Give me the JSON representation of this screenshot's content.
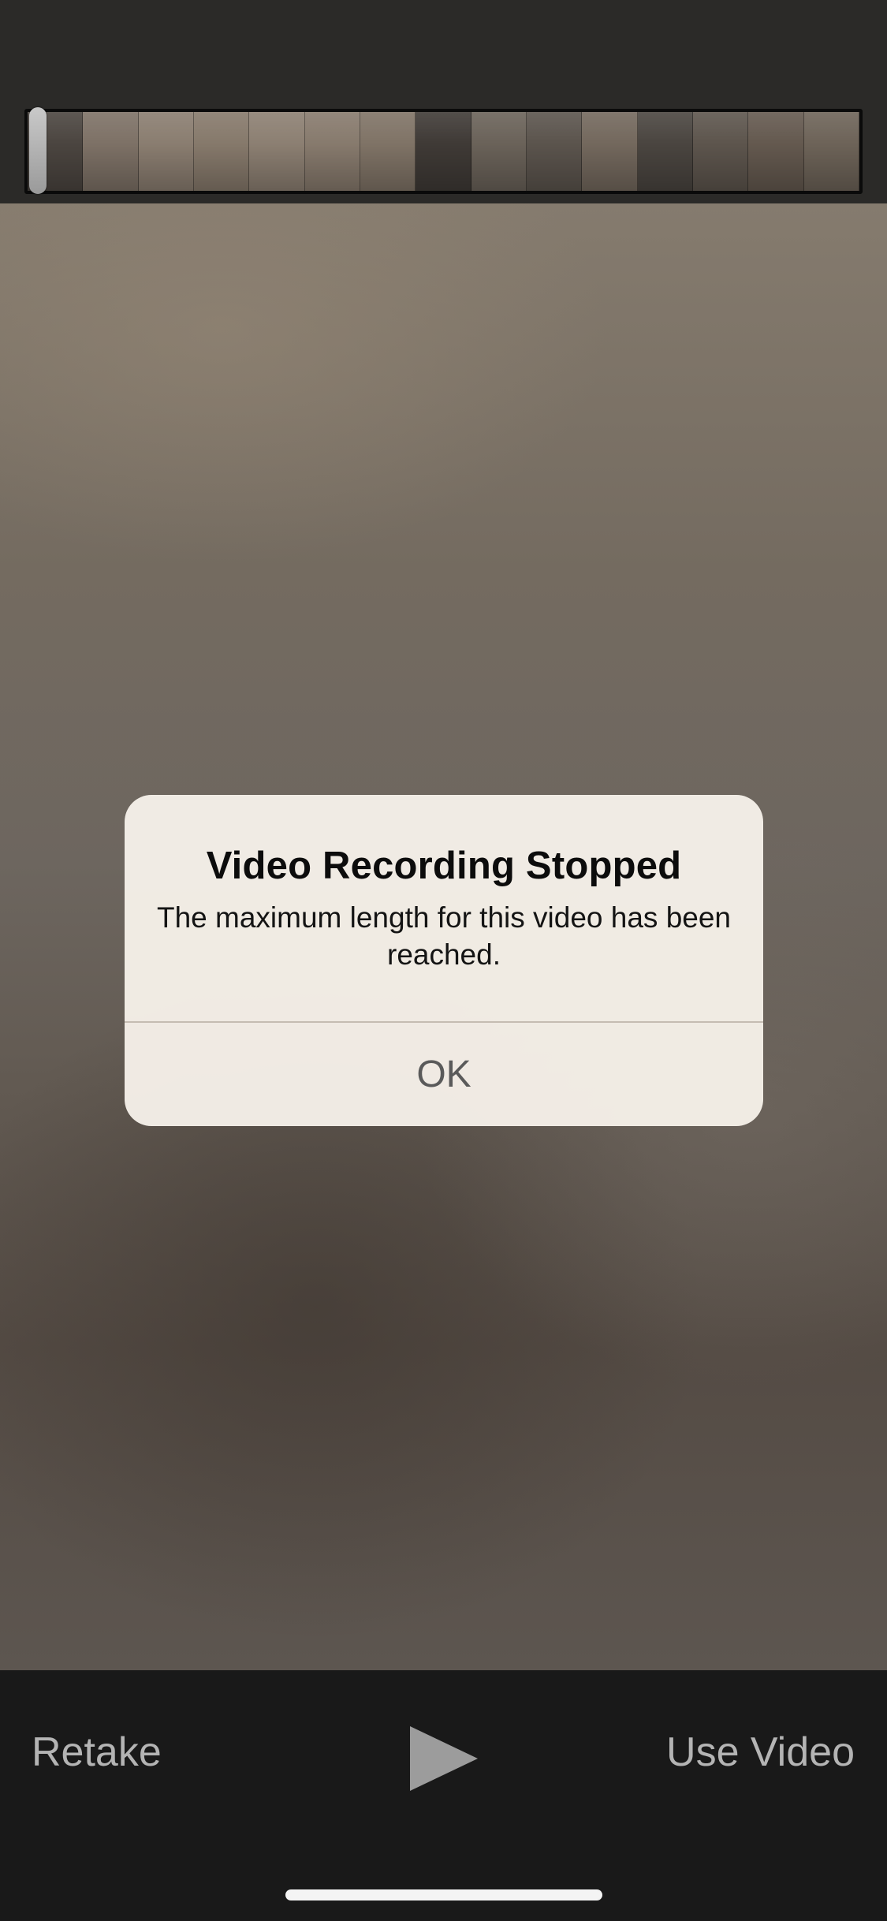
{
  "alert": {
    "title": "Video Recording Stopped",
    "message": "The maximum length for this video has been reached.",
    "ok_label": "OK"
  },
  "toolbar": {
    "retake_label": "Retake",
    "use_video_label": "Use Video",
    "play_icon": "play-icon"
  },
  "timeline": {
    "frame_count": 15,
    "frame_tones": [
      "#4b4540",
      "#7d7166",
      "#8a7d70",
      "#86796b",
      "#8c7f72",
      "#877a6d",
      "#7f7366",
      "#3f3a36",
      "#6a6259",
      "#5b544d",
      "#73685d",
      "#4a4540",
      "#5d554d",
      "#64594f",
      "#6d6358"
    ],
    "playhead_position": 0
  },
  "colors": {
    "alert_background": "#f6f0e9",
    "toolbar_text": "#b4b4b4",
    "toolbar_background": "#191919"
  }
}
